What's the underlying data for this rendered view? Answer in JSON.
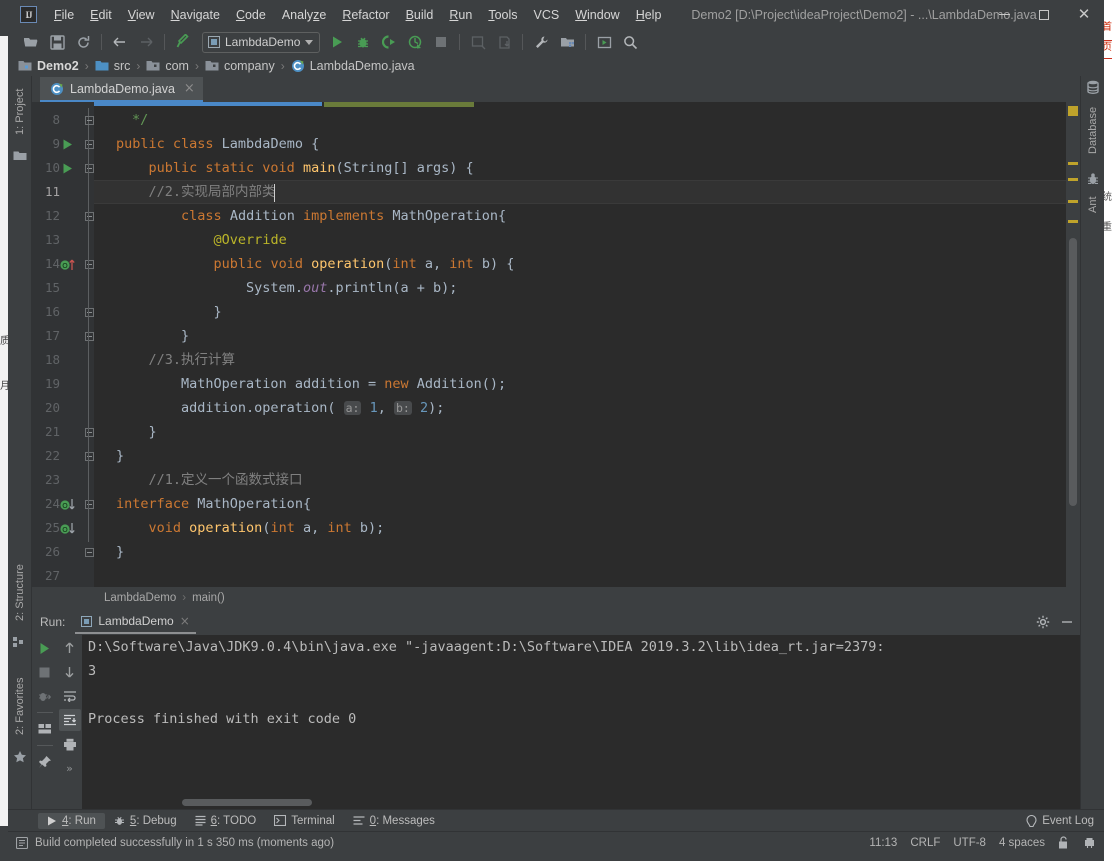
{
  "window": {
    "title": "Demo2 [D:\\Project\\ideaProject\\Demo2] - ...\\LambdaDemo.java",
    "logo": "IJ",
    "minimize": "minimize-icon",
    "maximize": "maximize-icon",
    "close": "close-icon"
  },
  "menu": [
    {
      "label": "File",
      "mnemonic": "F"
    },
    {
      "label": "Edit",
      "mnemonic": "E"
    },
    {
      "label": "View",
      "mnemonic": "V"
    },
    {
      "label": "Navigate",
      "mnemonic": "N"
    },
    {
      "label": "Code",
      "mnemonic": "C"
    },
    {
      "label": "Analyze",
      "mnemonic": "z"
    },
    {
      "label": "Refactor",
      "mnemonic": "R"
    },
    {
      "label": "Build",
      "mnemonic": "B"
    },
    {
      "label": "Run",
      "mnemonic": "R"
    },
    {
      "label": "Tools",
      "mnemonic": "T"
    },
    {
      "label": "VCS",
      "mnemonic": ""
    },
    {
      "label": "Window",
      "mnemonic": "W"
    },
    {
      "label": "Help",
      "mnemonic": "H"
    }
  ],
  "toolbar": {
    "icons": [
      "open-folder-icon",
      "save-all-icon",
      "sync-icon",
      "back-arrow-icon",
      "forward-arrow-icon",
      "build-hammer-icon"
    ],
    "run_config": "LambdaDemo",
    "run_icons": [
      "run-icon",
      "debug-icon",
      "run-with-coverage-icon",
      "profile-icon",
      "stop-icon",
      "update-app-icon",
      "pull-icon",
      "settings-wrench-icon",
      "project-structure-icon",
      "select-in-icon",
      "search-everywhere-icon"
    ]
  },
  "breadcrumb": {
    "items": [
      {
        "label": "Demo2",
        "icon": "module-icon"
      },
      {
        "label": "src",
        "icon": "source-folder-icon"
      },
      {
        "label": "com",
        "icon": "package-icon"
      },
      {
        "label": "company",
        "icon": "package-icon"
      },
      {
        "label": "LambdaDemo.java",
        "icon": "java-class-icon"
      }
    ],
    "separator": "›"
  },
  "editor_tabs": [
    {
      "label": "LambdaDemo.java",
      "icon": "java-class-icon",
      "active": true,
      "close": "×"
    }
  ],
  "left_tool_windows": [
    {
      "label": "1: Project",
      "icon": "project-icon"
    },
    {
      "label": "2: Structure",
      "icon": "structure-icon"
    },
    {
      "label": "2: Favorites",
      "icon": "favorites-star-icon"
    }
  ],
  "right_tool_windows": [
    {
      "label": "Database",
      "icon": "database-icon"
    },
    {
      "label": "Ant",
      "icon": "ant-bug-icon"
    }
  ],
  "editor": {
    "first_line": 8,
    "current_line": 11,
    "lines": [
      {
        "n": 8,
        "indent": 1,
        "tokens": [
          {
            "t": "*/",
            "c": "grn"
          }
        ],
        "gutter": "",
        "fold": "end"
      },
      {
        "n": 9,
        "indent": 0,
        "tokens": [
          {
            "t": "public class ",
            "c": "kw"
          },
          {
            "t": "LambdaDemo ",
            "c": "cls"
          },
          {
            "t": "{",
            "c": "nm"
          }
        ],
        "gutter": "run-gutter-icon",
        "fold": "start"
      },
      {
        "n": 10,
        "indent": 1,
        "tokens": [
          {
            "t": "public static void ",
            "c": "kw"
          },
          {
            "t": "main",
            "c": "mth"
          },
          {
            "t": "(",
            "c": "nm"
          },
          {
            "t": "String[] args",
            "c": "cls"
          },
          {
            "t": ") {",
            "c": "nm"
          }
        ],
        "gutter": "run-gutter-icon",
        "fold": "start"
      },
      {
        "n": 11,
        "indent": 1,
        "tokens": [
          {
            "t": "//2.实现局部内部类",
            "c": "cmt"
          }
        ],
        "gutter": "",
        "fold": ""
      },
      {
        "n": 12,
        "indent": 2,
        "tokens": [
          {
            "t": "class ",
            "c": "kw"
          },
          {
            "t": "Addition ",
            "c": "cls"
          },
          {
            "t": "implements ",
            "c": "kw"
          },
          {
            "t": "MathOperation{",
            "c": "cls"
          }
        ],
        "gutter": "",
        "fold": "start"
      },
      {
        "n": 13,
        "indent": 3,
        "tokens": [
          {
            "t": "@Override",
            "c": "ann"
          }
        ],
        "gutter": "",
        "fold": ""
      },
      {
        "n": 14,
        "indent": 3,
        "tokens": [
          {
            "t": "public void ",
            "c": "kw"
          },
          {
            "t": "operation",
            "c": "mth"
          },
          {
            "t": "(",
            "c": "nm"
          },
          {
            "t": "int ",
            "c": "kw"
          },
          {
            "t": "a, ",
            "c": "nm"
          },
          {
            "t": "int ",
            "c": "kw"
          },
          {
            "t": "b",
            "c": "nm"
          },
          {
            "t": ") {",
            "c": "nm"
          }
        ],
        "gutter": "implements-up-icon",
        "fold": "start"
      },
      {
        "n": 15,
        "indent": 4,
        "tokens": [
          {
            "t": "System.",
            "c": "cls"
          },
          {
            "t": "out",
            "c": "fld"
          },
          {
            "t": ".println(a + b);",
            "c": "nm"
          }
        ],
        "gutter": "",
        "fold": ""
      },
      {
        "n": 16,
        "indent": 3,
        "tokens": [
          {
            "t": "}",
            "c": "nm"
          }
        ],
        "gutter": "",
        "fold": "end"
      },
      {
        "n": 17,
        "indent": 2,
        "tokens": [
          {
            "t": "}",
            "c": "nm"
          }
        ],
        "gutter": "",
        "fold": "end"
      },
      {
        "n": 18,
        "indent": 1,
        "tokens": [
          {
            "t": "//3.执行计算",
            "c": "cmt"
          }
        ],
        "gutter": "",
        "fold": ""
      },
      {
        "n": 19,
        "indent": 2,
        "tokens": [
          {
            "t": "MathOperation addition = ",
            "c": "cls"
          },
          {
            "t": "new ",
            "c": "kw"
          },
          {
            "t": "Addition();",
            "c": "cls"
          }
        ],
        "gutter": "",
        "fold": ""
      },
      {
        "n": 20,
        "indent": 2,
        "tokens": [
          {
            "t": "addition.operation( ",
            "c": "nm"
          },
          {
            "t": "a:",
            "c": "hint"
          },
          {
            "t": " ",
            "c": "nm"
          },
          {
            "t": "1",
            "c": "num"
          },
          {
            "t": ", ",
            "c": "nm"
          },
          {
            "t": "b:",
            "c": "hint"
          },
          {
            "t": " ",
            "c": "nm"
          },
          {
            "t": "2",
            "c": "num"
          },
          {
            "t": ");",
            "c": "nm"
          }
        ],
        "gutter": "",
        "fold": ""
      },
      {
        "n": 21,
        "indent": 1,
        "tokens": [
          {
            "t": "}",
            "c": "nm"
          }
        ],
        "gutter": "",
        "fold": "end"
      },
      {
        "n": 22,
        "indent": 0,
        "tokens": [
          {
            "t": "}",
            "c": "nm"
          }
        ],
        "gutter": "",
        "fold": "end"
      },
      {
        "n": 23,
        "indent": 1,
        "tokens": [
          {
            "t": "//1.定义一个函数式接口",
            "c": "cmt"
          }
        ],
        "gutter": "",
        "fold": ""
      },
      {
        "n": 24,
        "indent": 0,
        "tokens": [
          {
            "t": "interface ",
            "c": "kw"
          },
          {
            "t": "MathOperation{",
            "c": "cls"
          }
        ],
        "gutter": "implemented-by-icon",
        "fold": "start"
      },
      {
        "n": 25,
        "indent": 1,
        "tokens": [
          {
            "t": "void ",
            "c": "kw"
          },
          {
            "t": "operation",
            "c": "mth"
          },
          {
            "t": "(",
            "c": "nm"
          },
          {
            "t": "int ",
            "c": "kw"
          },
          {
            "t": "a, ",
            "c": "nm"
          },
          {
            "t": "int ",
            "c": "kw"
          },
          {
            "t": "b",
            "c": "nm"
          },
          {
            "t": ");",
            "c": "nm"
          }
        ],
        "gutter": "implemented-by-icon",
        "fold": ""
      },
      {
        "n": 26,
        "indent": 0,
        "tokens": [
          {
            "t": "}",
            "c": "nm"
          }
        ],
        "gutter": "",
        "fold": "end"
      },
      {
        "n": 27,
        "indent": 0,
        "tokens": [],
        "gutter": "",
        "fold": ""
      }
    ]
  },
  "editor_breadcrumb": {
    "items": [
      "LambdaDemo",
      "main()"
    ],
    "separator": "›"
  },
  "run_window": {
    "label": "Run:",
    "tab": "LambdaDemo",
    "tab_close": "×",
    "settings_icon": "gear-icon",
    "minimize_icon": "minimize-icon",
    "tool_icons_left": [
      "rerun-icon",
      "stop-icon",
      "rerun-failed-icon",
      "layout-icon",
      "pin-icon"
    ],
    "tool_icons_right": [
      "up-arrow-icon",
      "down-arrow-icon",
      "soft-wrap-icon",
      "scroll-to-end-icon",
      "print-icon",
      "expand-more-icon"
    ],
    "console_lines": [
      "D:\\Software\\Java\\JDK9.0.4\\bin\\java.exe \"-javaagent:D:\\Software\\IDEA 2019.3.2\\lib\\idea_rt.jar=2379:",
      "3",
      "",
      "Process finished with exit code 0"
    ]
  },
  "bottom_tabs": [
    {
      "label": "4: Run",
      "mnemonic": "4",
      "icon": "run-icon",
      "active": true
    },
    {
      "label": "5: Debug",
      "mnemonic": "5",
      "icon": "debug-icon",
      "active": false
    },
    {
      "label": "6: TODO",
      "mnemonic": "6",
      "icon": "todo-icon",
      "active": false
    },
    {
      "label": "Terminal",
      "mnemonic": "",
      "icon": "terminal-icon",
      "active": false
    },
    {
      "label": "0: Messages",
      "mnemonic": "0",
      "icon": "messages-icon",
      "active": false
    }
  ],
  "event_log": {
    "label": "Event Log",
    "icon": "event-log-icon"
  },
  "status_bar": {
    "message": "Build completed successfully in 1 s 350 ms (moments ago)",
    "message_icon": "info-icon",
    "position": "11:13",
    "line_separator": "CRLF",
    "encoding": "UTF-8",
    "indent": "4 spaces",
    "lock_icon": "unlocked-icon",
    "trash_icon": "inspector-icon"
  },
  "colors": {
    "bg_chrome": "#3c3f41",
    "bg_editor": "#2b2b2b",
    "accent_tab": "#4a88c7",
    "keyword": "#cc7832",
    "method": "#ffc66d",
    "identifier": "#a9b7c6",
    "field": "#9876aa",
    "annotation": "#bbb529",
    "number": "#6897bb",
    "comment": "#808080",
    "doc_comment": "#629755",
    "marker_warning": "#bfa32b",
    "run_green": "#499c54"
  }
}
